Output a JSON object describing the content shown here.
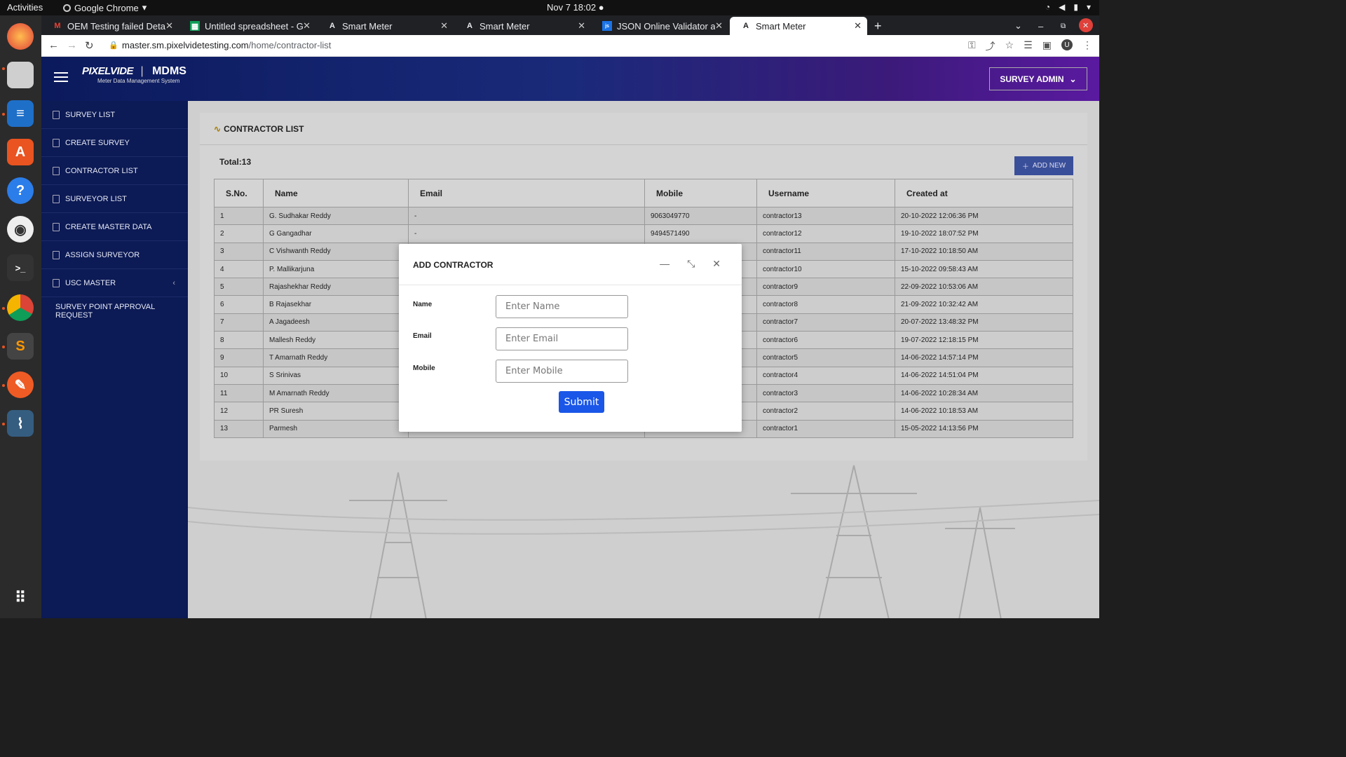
{
  "os": {
    "activities": "Activities",
    "app_name": "Google Chrome",
    "clock": "Nov 7  18:02"
  },
  "browser": {
    "tabs": [
      {
        "title": "OEM Testing failed Detail",
        "favicon": "gmail-icon"
      },
      {
        "title": "Untitled spreadsheet - Go",
        "favicon": "sheets-icon"
      },
      {
        "title": "Smart Meter",
        "favicon": "angular-icon"
      },
      {
        "title": "Smart Meter",
        "favicon": "angular-icon"
      },
      {
        "title": "JSON Online Validator an",
        "favicon": "json-icon"
      },
      {
        "title": "Smart Meter",
        "favicon": "angular-icon"
      }
    ],
    "url_host": "master.sm.pixelvidetesting.com",
    "url_path": "/home/contractor-list"
  },
  "header": {
    "brand": "PIXELVIDE",
    "product": "MDMS",
    "subtitle": "Meter Data Management System",
    "user_menu": "SURVEY ADMIN"
  },
  "sidebar": {
    "items": [
      {
        "label": "SURVEY LIST"
      },
      {
        "label": "CREATE SURVEY"
      },
      {
        "label": "CONTRACTOR LIST"
      },
      {
        "label": "SURVEYOR LIST"
      },
      {
        "label": "CREATE MASTER DATA"
      },
      {
        "label": "ASSIGN SURVEYOR"
      },
      {
        "label": "USC MASTER"
      },
      {
        "label": "SURVEY POINT APPROVAL REQUEST"
      }
    ]
  },
  "main": {
    "title": "CONTRACTOR LIST",
    "total": "Total:13",
    "add_new": "ADD NEW",
    "columns": [
      "S.No.",
      "Name",
      "Email",
      "Mobile",
      "Username",
      "Created at"
    ],
    "rows": [
      [
        "1",
        "G. Sudhakar Reddy",
        "-",
        "9063049770",
        "contractor13",
        "20-10-2022 12:06:36 PM"
      ],
      [
        "2",
        "G Gangadhar",
        "-",
        "9494571490",
        "contractor12",
        "19-10-2022 18:07:52 PM"
      ],
      [
        "3",
        "C Vishwanth Reddy",
        "",
        "",
        "contractor11",
        "17-10-2022 10:18:50 AM"
      ],
      [
        "4",
        "P. Mallikarjuna",
        "",
        "",
        "contractor10",
        "15-10-2022 09:58:43 AM"
      ],
      [
        "5",
        "Rajashekhar Reddy",
        "",
        "",
        "contractor9",
        "22-09-2022 10:53:06 AM"
      ],
      [
        "6",
        "B Rajasekhar",
        "",
        "",
        "contractor8",
        "21-09-2022 10:32:42 AM"
      ],
      [
        "7",
        "A Jagadeesh",
        "",
        "",
        "contractor7",
        "20-07-2022 13:48:32 PM"
      ],
      [
        "8",
        "Mallesh Reddy",
        "",
        "",
        "contractor6",
        "19-07-2022 12:18:15 PM"
      ],
      [
        "9",
        "T Amarnath Reddy",
        "",
        "",
        "contractor5",
        "14-06-2022 14:57:14 PM"
      ],
      [
        "10",
        "S Srinivas",
        "",
        "",
        "contractor4",
        "14-06-2022 14:51:04 PM"
      ],
      [
        "11",
        "M Amarnath Reddy",
        "",
        "",
        "contractor3",
        "14-06-2022 10:28:34 AM"
      ],
      [
        "12",
        "PR Suresh",
        "",
        "",
        "contractor2",
        "14-06-2022 10:18:53 AM"
      ],
      [
        "13",
        "Parmesh",
        "",
        "",
        "contractor1",
        "15-05-2022 14:13:56 PM"
      ]
    ]
  },
  "modal": {
    "title": "ADD CONTRACTOR",
    "name_label": "Name",
    "name_placeholder": "Enter Name",
    "email_label": "Email",
    "email_placeholder": "Enter Email",
    "mobile_label": "Mobile",
    "mobile_placeholder": "Enter Mobile",
    "submit": "Submit"
  },
  "colors": {
    "sidebar": "#0c1a55",
    "accent": "#1a56e8",
    "add_new": "#3a4f9a"
  }
}
